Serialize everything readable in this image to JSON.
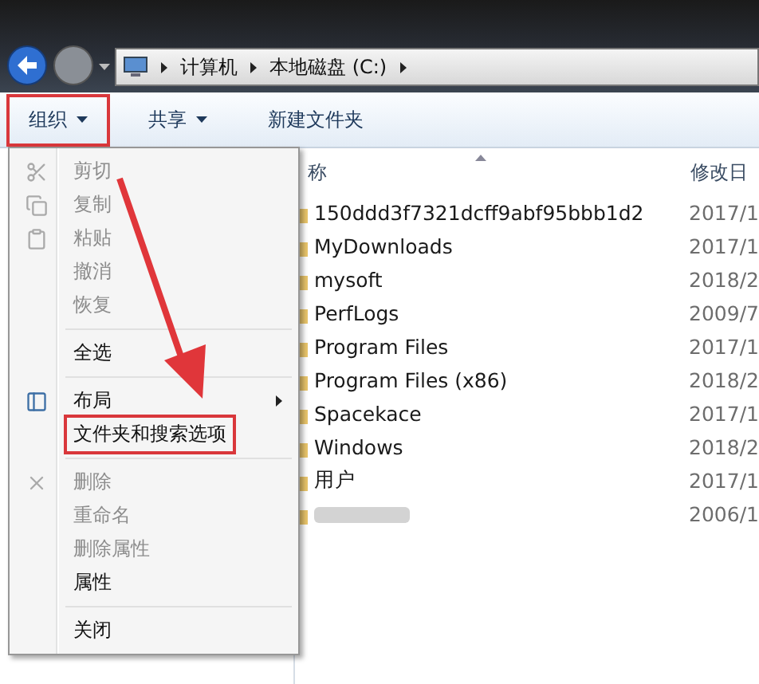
{
  "address_bar": {
    "crumbs": [
      "计算机",
      "本地磁盘 (C:)"
    ]
  },
  "toolbar": [
    {
      "label": "组织",
      "dropdown": true,
      "highlighted": true
    },
    {
      "label": "共享",
      "dropdown": true,
      "highlighted": false
    },
    {
      "label": "新建文件夹",
      "dropdown": false,
      "highlighted": false
    }
  ],
  "columns": [
    "称",
    "修改日"
  ],
  "rows": [
    {
      "name": "150ddd3f7321dcff9abf95bbb1d2",
      "date": "2017/1"
    },
    {
      "name": "MyDownloads",
      "date": "2017/1"
    },
    {
      "name": "mysoft",
      "date": "2018/2"
    },
    {
      "name": "PerfLogs",
      "date": "2009/7"
    },
    {
      "name": "Program Files",
      "date": "2017/1"
    },
    {
      "name": "Program Files (x86)",
      "date": "2018/2"
    },
    {
      "name": "Spacekace",
      "date": "2017/1"
    },
    {
      "name": "Windows",
      "date": "2018/2"
    },
    {
      "name": "用户",
      "date": "2017/1"
    },
    {
      "name": "",
      "blurred": true,
      "date": "2006/1"
    }
  ],
  "menu": [
    {
      "kind": "command",
      "label": "剪切",
      "disabled": true,
      "highlighted": false
    },
    {
      "kind": "command",
      "label": "复制",
      "disabled": true,
      "highlighted": false
    },
    {
      "kind": "command",
      "label": "粘贴",
      "disabled": true,
      "highlighted": false
    },
    {
      "kind": "command",
      "label": "撤消",
      "disabled": true,
      "highlighted": false
    },
    {
      "kind": "command",
      "label": "恢复",
      "disabled": true,
      "highlighted": false
    },
    {
      "kind": "separator"
    },
    {
      "kind": "command",
      "label": "全选",
      "disabled": false,
      "highlighted": false
    },
    {
      "kind": "separator"
    },
    {
      "kind": "submenu",
      "label": "布局",
      "disabled": false,
      "highlighted": false
    },
    {
      "kind": "command",
      "label": "文件夹和搜索选项",
      "disabled": false,
      "highlighted": true
    },
    {
      "kind": "separator"
    },
    {
      "kind": "command",
      "label": "删除",
      "disabled": true,
      "highlighted": false
    },
    {
      "kind": "command",
      "label": "重命名",
      "disabled": true,
      "highlighted": false
    },
    {
      "kind": "command",
      "label": "删除属性",
      "disabled": true,
      "highlighted": false
    },
    {
      "kind": "command",
      "label": "属性",
      "disabled": false,
      "highlighted": false
    },
    {
      "kind": "separator"
    },
    {
      "kind": "command",
      "label": "关闭",
      "disabled": false,
      "highlighted": false
    }
  ]
}
